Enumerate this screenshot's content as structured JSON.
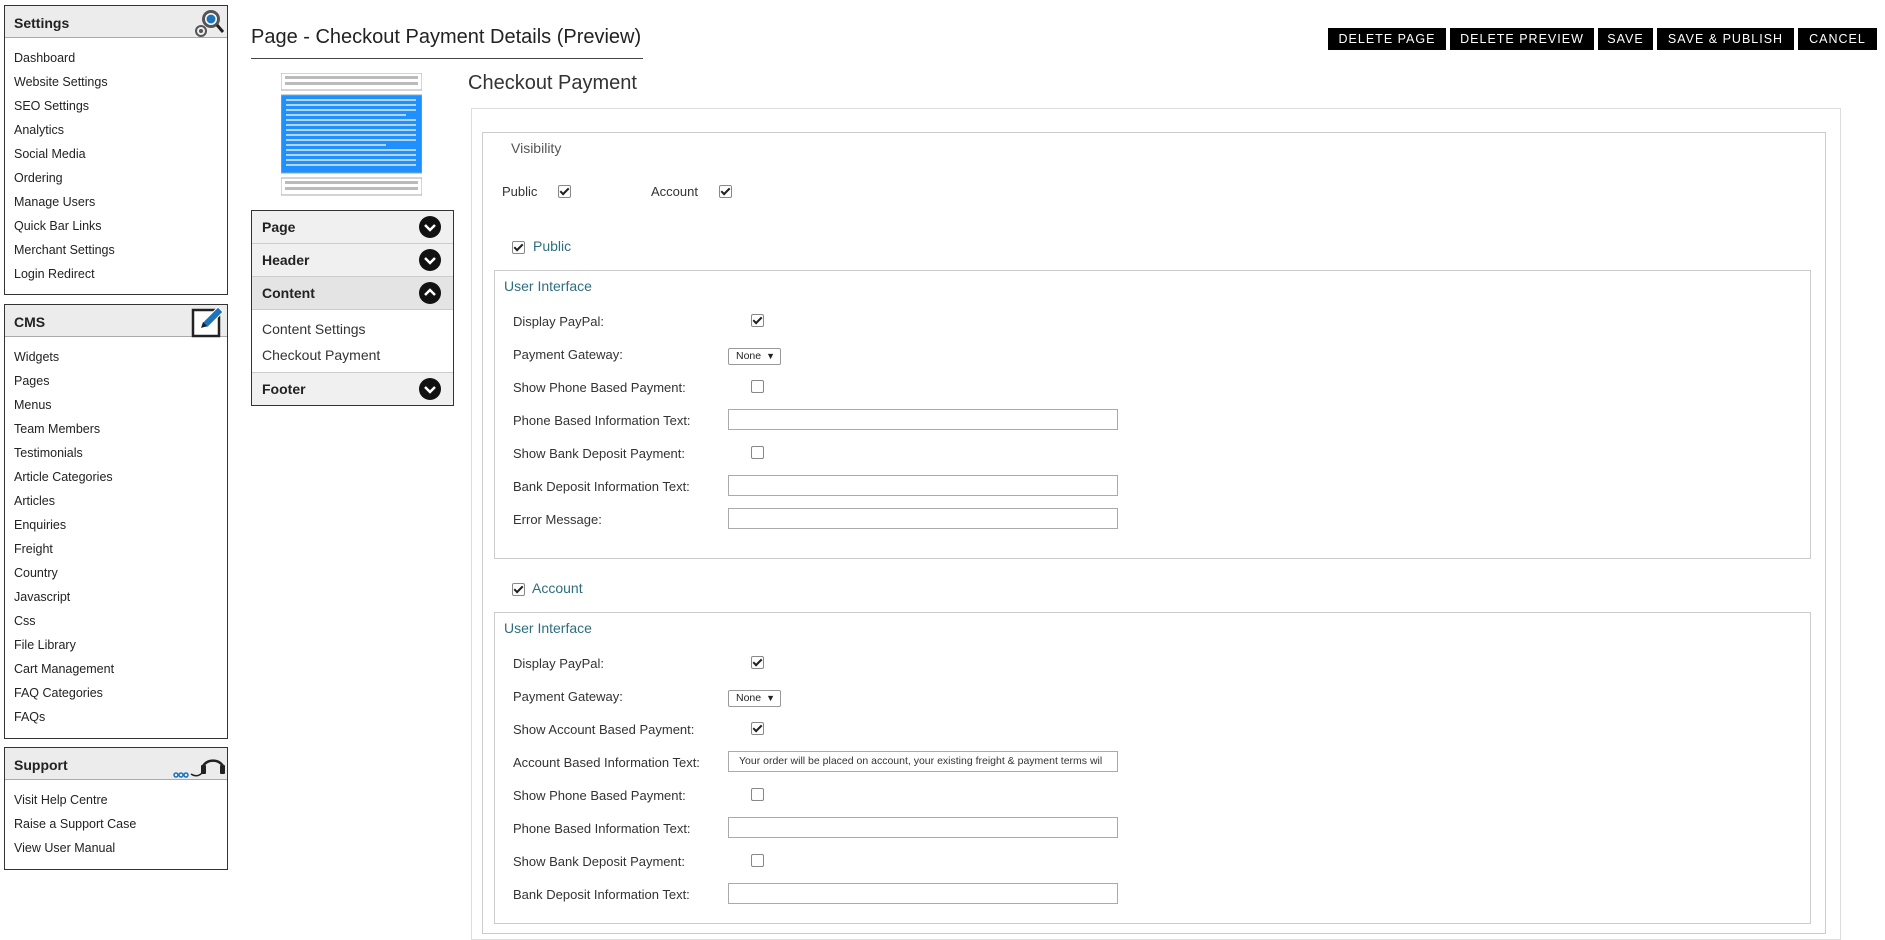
{
  "sidebar": {
    "settings": {
      "title": "Settings",
      "items": [
        "Dashboard",
        "Website Settings",
        "SEO Settings",
        "Analytics",
        "Social Media",
        "Ordering",
        "Manage Users",
        "Quick Bar Links",
        "Merchant Settings",
        "Login Redirect"
      ]
    },
    "cms": {
      "title": "CMS",
      "items": [
        "Widgets",
        "Pages",
        "Menus",
        "Team Members",
        "Testimonials",
        "Article Categories",
        "Articles",
        "Enquiries",
        "Freight",
        "Country",
        "Javascript",
        "Css",
        "File Library",
        "Cart Management",
        "FAQ Categories",
        "FAQs"
      ]
    },
    "support": {
      "title": "Support",
      "items": [
        "Visit Help Centre",
        "Raise a Support Case",
        "View User Manual"
      ]
    }
  },
  "header": {
    "title": "Page - Checkout Payment Details (Preview)",
    "buttons": [
      "DELETE PAGE",
      "DELETE PREVIEW",
      "SAVE",
      "SAVE & PUBLISH",
      "CANCEL"
    ]
  },
  "accordion": {
    "page": "Page",
    "header": "Header",
    "content": "Content",
    "content_items": [
      "Content Settings",
      "Checkout Payment"
    ],
    "footer": "Footer"
  },
  "main": {
    "section_title": "Checkout Payment",
    "visibility": {
      "label": "Visibility",
      "public_label": "Public",
      "public_checked": true,
      "account_label": "Account",
      "account_checked": true
    },
    "public": {
      "title": "Public",
      "checked": true,
      "ui_title": "User Interface",
      "display_paypal": {
        "label": "Display PayPal:",
        "checked": true
      },
      "payment_gateway": {
        "label": "Payment Gateway:",
        "value": "None"
      },
      "show_phone": {
        "label": "Show Phone Based Payment:",
        "checked": false
      },
      "phone_text": {
        "label": "Phone Based Information Text:",
        "value": ""
      },
      "show_bank": {
        "label": "Show Bank Deposit Payment:",
        "checked": false
      },
      "bank_text": {
        "label": "Bank Deposit Information Text:",
        "value": ""
      },
      "error": {
        "label": "Error Message:",
        "value": ""
      }
    },
    "account": {
      "title": "Account",
      "checked": true,
      "ui_title": "User Interface",
      "display_paypal": {
        "label": "Display PayPal:",
        "checked": true
      },
      "payment_gateway": {
        "label": "Payment Gateway:",
        "value": "None"
      },
      "show_account": {
        "label": "Show Account Based Payment:",
        "checked": true
      },
      "account_text": {
        "label": "Account Based Information Text:",
        "value": "Your order will be placed on account, your existing freight & payment terms wil"
      },
      "show_phone": {
        "label": "Show Phone Based Payment:",
        "checked": false
      },
      "phone_text": {
        "label": "Phone Based Information Text:",
        "value": ""
      },
      "show_bank": {
        "label": "Show Bank Deposit Payment:",
        "checked": false
      },
      "bank_text": {
        "label": "Bank Deposit Information Text:",
        "value": ""
      }
    }
  },
  "colors": {
    "accent": "#2e6e7e",
    "thumb_highlight": "#1e90ff"
  },
  "icons": {
    "settings": "gear-search-icon",
    "cms": "edit-icon",
    "support": "headset-icon",
    "chevron": "chevron-icon"
  }
}
